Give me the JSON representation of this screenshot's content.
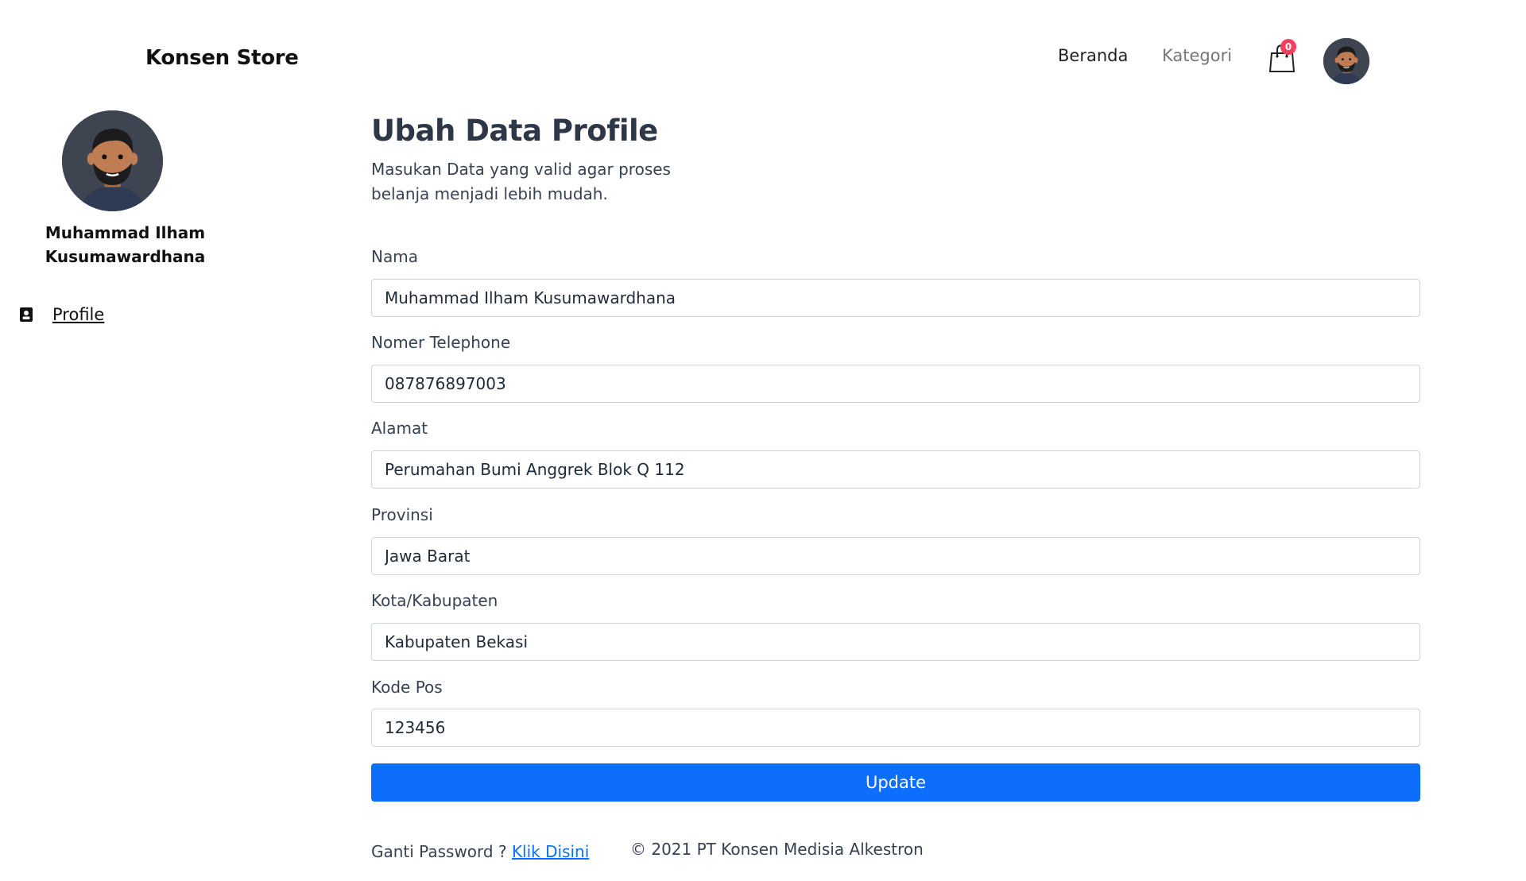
{
  "header": {
    "brand": "Konsen Store",
    "nav": {
      "home": "Beranda",
      "category": "Kategori"
    },
    "cart_count": "0"
  },
  "sidebar": {
    "user_name": "Muhammad Ilham Kusumawardhana",
    "menu": [
      {
        "label": "Profile",
        "icon": "contact-card-icon"
      }
    ]
  },
  "main": {
    "title": "Ubah Data Profile",
    "subtitle": "Masukan Data yang valid agar proses belanja menjadi lebih mudah.",
    "fields": [
      {
        "label": "Nama",
        "value": "Muhammad Ilham Kusumawardhana"
      },
      {
        "label": "Nomer Telephone",
        "value": "087876897003"
      },
      {
        "label": "Alamat",
        "value": "Perumahan Bumi Anggrek Blok Q 112"
      },
      {
        "label": "Provinsi",
        "value": "Jawa Barat"
      },
      {
        "label": "Kota/Kabupaten",
        "value": "Kabupaten Bekasi"
      },
      {
        "label": "Kode Pos",
        "value": "123456"
      }
    ],
    "update_label": "Update",
    "password_prompt": "Ganti Password ?",
    "password_link": "Klik Disini"
  },
  "footer": {
    "copyright": "© 2021 PT Konsen Medisia Alkestron"
  },
  "colors": {
    "primary": "#0d6efd",
    "badge": "#f43f5e",
    "heading": "#2d3748"
  }
}
